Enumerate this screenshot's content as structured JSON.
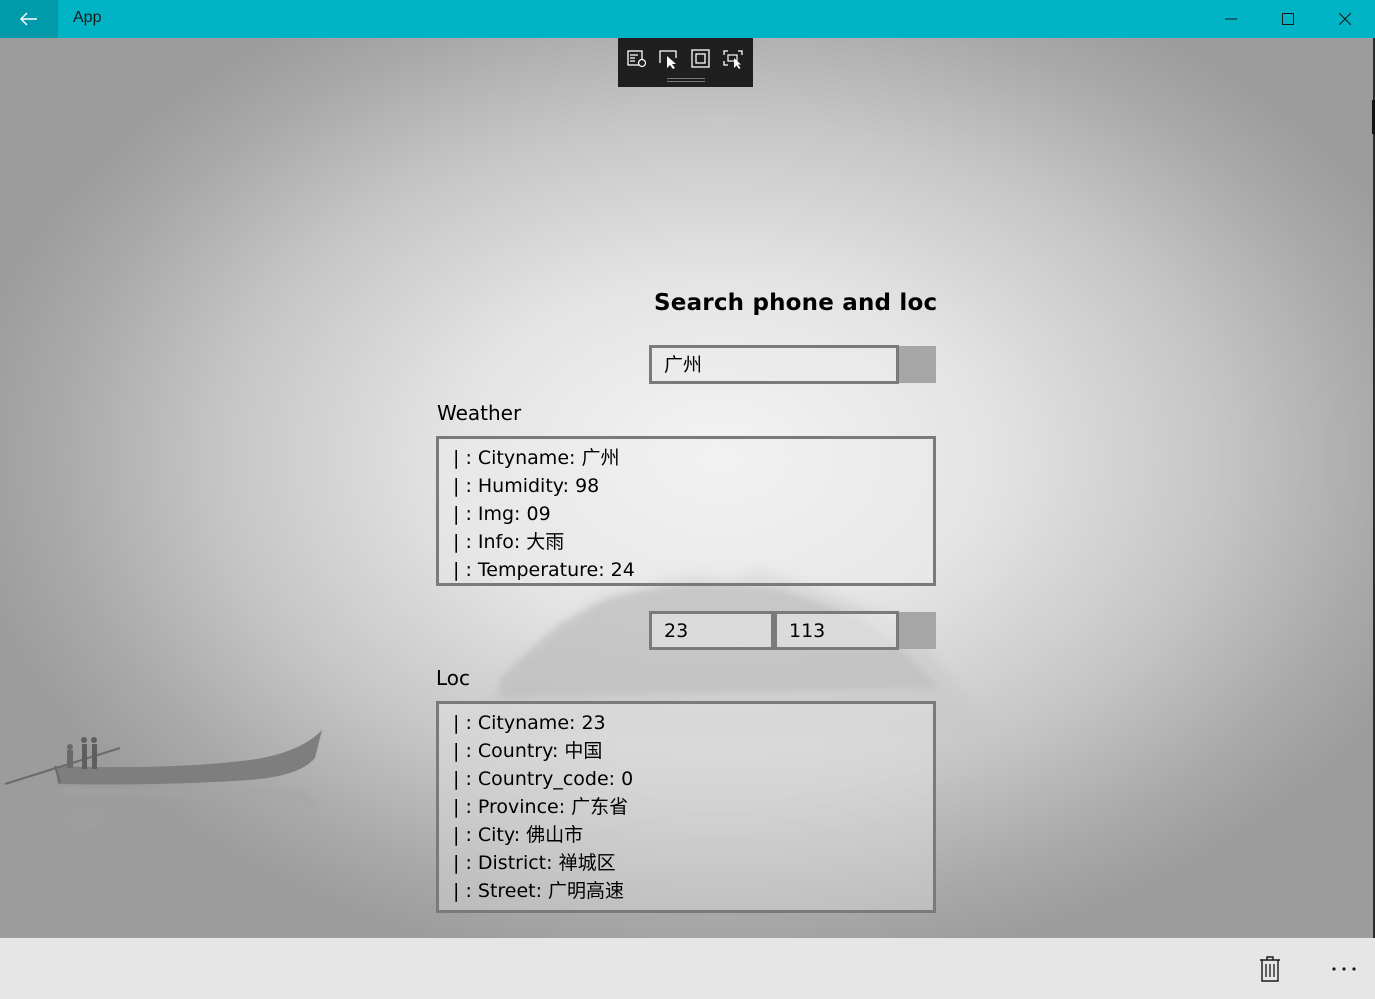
{
  "titlebar": {
    "app_title": "App",
    "back_icon": "arrow-left-icon",
    "controls": [
      "minimize-icon",
      "maximize-icon",
      "close-icon"
    ]
  },
  "devtools": {
    "tools": [
      "live-visual-tree-icon",
      "select-element-icon",
      "display-layout-adorners-icon",
      "track-focused-element-icon"
    ]
  },
  "search": {
    "heading": "Search phone and loc",
    "query_value": "广州"
  },
  "weather": {
    "label": "Weather",
    "lines": [
      "| : Cityname: 广州",
      "| : Humidity: 98",
      "| : Img: 09",
      "| : Info: 大雨",
      "| : Temperature: 24"
    ]
  },
  "coords": {
    "lat_value": "23",
    "lng_value": "113"
  },
  "loc": {
    "label": "Loc",
    "lines": [
      "| : Cityname: 23",
      "| : Country: 中国",
      "| : Country_code: 0",
      "| : Province: 广东省",
      "| : City: 佛山市",
      "| : District: 禅城区",
      "| : Street: 广明高速"
    ]
  },
  "commandbar": {
    "buttons": [
      "delete-icon",
      "more-icon"
    ]
  },
  "colors": {
    "titlebar": "#00b4c6",
    "back_button": "#009aab",
    "devtools_bg": "#1f1f1f",
    "button_gray": "#a6a6a6",
    "border_gray": "#7a7a7a"
  }
}
